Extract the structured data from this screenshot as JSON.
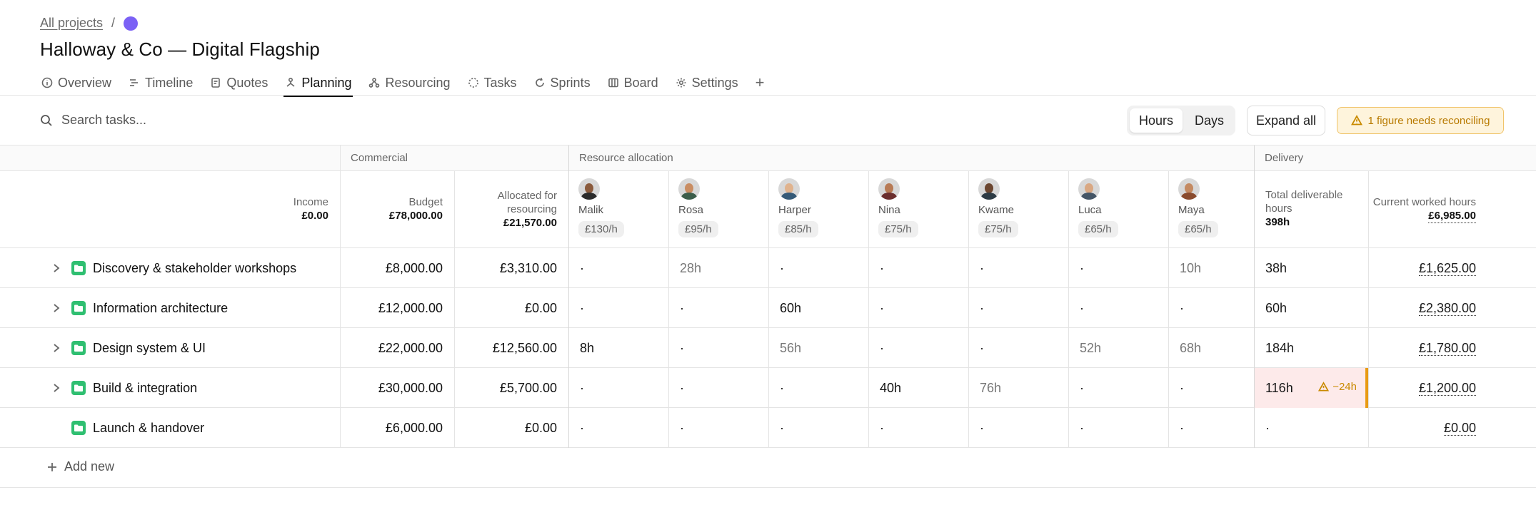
{
  "breadcrumb": {
    "all_projects": "All projects",
    "separator": "/"
  },
  "project": {
    "title": "Halloway & Co — Digital Flagship",
    "color": "#7b61f5"
  },
  "tabs": [
    {
      "label": "Overview",
      "icon": "info-icon"
    },
    {
      "label": "Timeline",
      "icon": "timeline-icon"
    },
    {
      "label": "Quotes",
      "icon": "quotes-icon"
    },
    {
      "label": "Planning",
      "icon": "planning-icon",
      "active": true
    },
    {
      "label": "Resourcing",
      "icon": "resourcing-icon"
    },
    {
      "label": "Tasks",
      "icon": "tasks-icon"
    },
    {
      "label": "Sprints",
      "icon": "sprints-icon"
    },
    {
      "label": "Board",
      "icon": "board-icon"
    },
    {
      "label": "Settings",
      "icon": "gear-icon"
    }
  ],
  "add_tab": "+",
  "toolbar": {
    "search_placeholder": "Search tasks...",
    "unit_hours": "Hours",
    "unit_days": "Days",
    "unit_selected": "Hours",
    "expand_all": "Expand all",
    "warning": "1 figure needs reconciling"
  },
  "groups": {
    "commercial": "Commercial",
    "resource_allocation": "Resource allocation",
    "delivery": "Delivery"
  },
  "columns": {
    "income": {
      "label": "Income",
      "value": "£0.00"
    },
    "budget": {
      "label": "Budget",
      "value": "£78,000.00"
    },
    "allocated": {
      "label_1": "Allocated for",
      "label_2": "resourcing",
      "value": "£21,570.00"
    },
    "total_deliverable": {
      "label_1": "Total deliverable",
      "label_2": "hours",
      "value": "398h"
    },
    "current_worked": {
      "label": "Current worked hours",
      "value": "£6,985.00"
    }
  },
  "people": [
    {
      "name": "Malik",
      "rate": "£130/h",
      "skin": "#8a5a3c",
      "shirt": "#2b2b2b"
    },
    {
      "name": "Rosa",
      "rate": "£95/h",
      "skin": "#c98d62",
      "shirt": "#3b5d4a"
    },
    {
      "name": "Harper",
      "rate": "£85/h",
      "skin": "#e0b38e",
      "shirt": "#355a78"
    },
    {
      "name": "Nina",
      "rate": "£75/h",
      "skin": "#b77a55",
      "shirt": "#6b2e2e"
    },
    {
      "name": "Kwame",
      "rate": "£75/h",
      "skin": "#6b4630",
      "shirt": "#2d3b45"
    },
    {
      "name": "Luca",
      "rate": "£65/h",
      "skin": "#d9a883",
      "shirt": "#445566"
    },
    {
      "name": "Maya",
      "rate": "£65/h",
      "skin": "#c48a62",
      "shirt": "#8a4b2e"
    }
  ],
  "rows": [
    {
      "name": "Discovery & stakeholder workshops",
      "expandable": true,
      "budget": "£8,000.00",
      "allocated": "£3,310.00",
      "alloc": [
        "·",
        "28h",
        "·",
        "·",
        "·",
        "·",
        "10h"
      ],
      "alloc_muted": [
        false,
        true,
        false,
        false,
        false,
        false,
        true
      ],
      "total": "38h",
      "total_warn": false,
      "worked": "£1,625.00"
    },
    {
      "name": "Information architecture",
      "expandable": true,
      "budget": "£12,000.00",
      "allocated": "£0.00",
      "alloc": [
        "·",
        "·",
        "60h",
        "·",
        "·",
        "·",
        "·"
      ],
      "alloc_muted": [
        false,
        false,
        false,
        false,
        false,
        false,
        false
      ],
      "total": "60h",
      "total_warn": false,
      "worked": "£2,380.00"
    },
    {
      "name": "Design system & UI",
      "expandable": true,
      "budget": "£22,000.00",
      "allocated": "£12,560.00",
      "alloc": [
        "8h",
        "·",
        "56h",
        "·",
        "·",
        "52h",
        "68h"
      ],
      "alloc_muted": [
        false,
        false,
        true,
        false,
        false,
        true,
        true
      ],
      "total": "184h",
      "total_warn": false,
      "worked": "£1,780.00"
    },
    {
      "name": "Build & integration",
      "expandable": true,
      "budget": "£30,000.00",
      "allocated": "£5,700.00",
      "alloc": [
        "·",
        "·",
        "·",
        "40h",
        "76h",
        "·",
        "·"
      ],
      "alloc_muted": [
        false,
        false,
        false,
        false,
        true,
        false,
        false
      ],
      "total": "116h",
      "total_warn": true,
      "total_badge": "−24h",
      "worked": "£1,200.00"
    },
    {
      "name": "Launch & handover",
      "expandable": false,
      "budget": "£6,000.00",
      "allocated": "£0.00",
      "alloc": [
        "·",
        "·",
        "·",
        "·",
        "·",
        "·",
        "·"
      ],
      "alloc_muted": [
        false,
        false,
        false,
        false,
        false,
        false,
        false
      ],
      "total": "·",
      "total_warn": false,
      "worked": "£0.00"
    }
  ],
  "add_new": "Add new",
  "colors": {
    "accent": "#7b61f5",
    "folder": "#2fbf71",
    "warning": "#c98a00",
    "warning_bg": "#fef4dc",
    "error_bg": "#fdeaea"
  }
}
